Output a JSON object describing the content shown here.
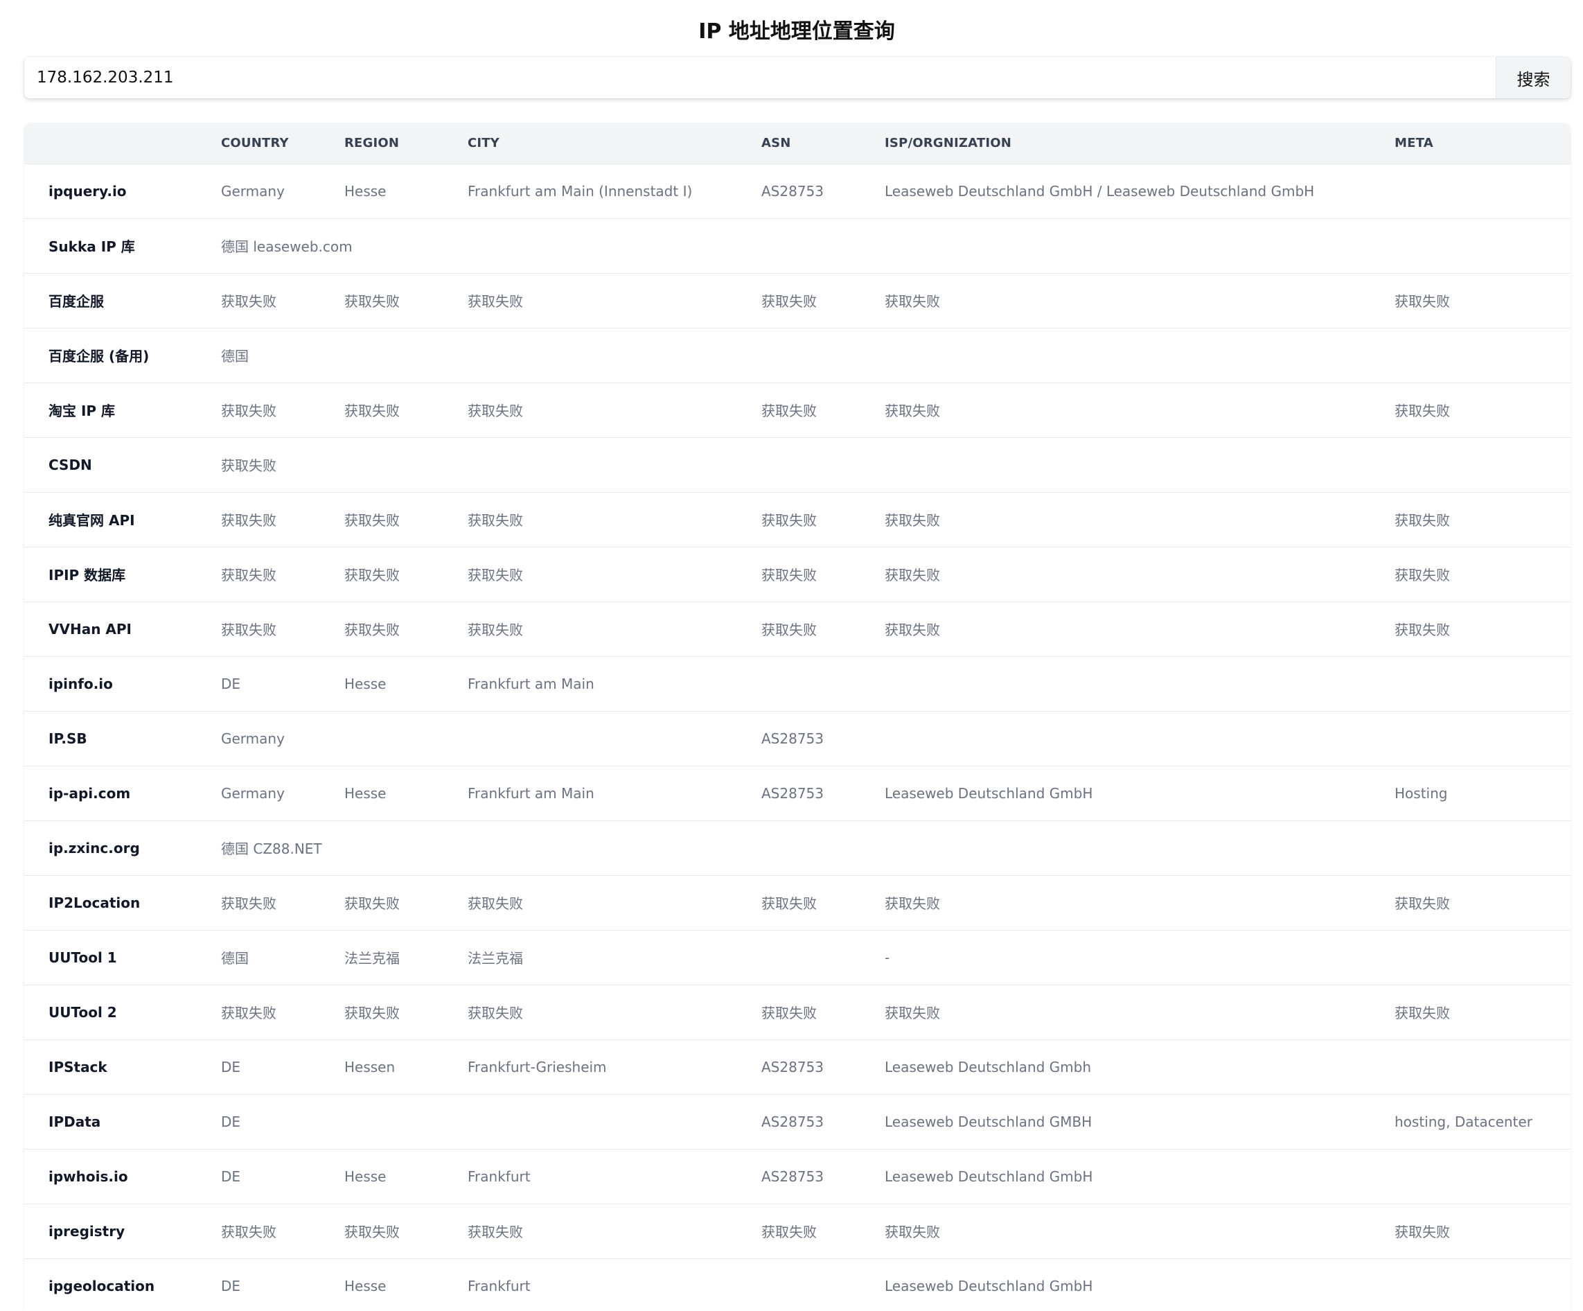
{
  "page": {
    "title": "IP 地址地理位置查询"
  },
  "search": {
    "value": "178.162.203.211",
    "button_label": "搜索"
  },
  "table": {
    "headers": [
      "",
      "COUNTRY",
      "REGION",
      "CITY",
      "ASN",
      "ISP/ORGNIZATION",
      "META"
    ],
    "rows": [
      {
        "cells": [
          "ipquery.io",
          "Germany",
          "Hesse",
          "Frankfurt am Main (Innenstadt I)",
          "AS28753",
          "Leaseweb Deutschland GmbH / Leaseweb Deutschland GmbH",
          ""
        ]
      },
      {
        "span": true,
        "cells": [
          "Sukka IP 库",
          "德国 leaseweb.com"
        ]
      },
      {
        "cells": [
          "百度企服",
          "获取失败",
          "获取失败",
          "获取失败",
          "获取失败",
          "获取失败",
          "获取失败"
        ]
      },
      {
        "span": true,
        "cells": [
          "百度企服 (备用)",
          "德国"
        ]
      },
      {
        "cells": [
          "淘宝 IP 库",
          "获取失败",
          "获取失败",
          "获取失败",
          "获取失败",
          "获取失败",
          "获取失败"
        ]
      },
      {
        "span": true,
        "cells": [
          "CSDN",
          "获取失败"
        ]
      },
      {
        "cells": [
          "纯真官网 API",
          "获取失败",
          "获取失败",
          "获取失败",
          "获取失败",
          "获取失败",
          "获取失败"
        ]
      },
      {
        "cells": [
          "IPIP 数据库",
          "获取失败",
          "获取失败",
          "获取失败",
          "获取失败",
          "获取失败",
          "获取失败"
        ]
      },
      {
        "cells": [
          "VVHan API",
          "获取失败",
          "获取失败",
          "获取失败",
          "获取失败",
          "获取失败",
          "获取失败"
        ]
      },
      {
        "cells": [
          "ipinfo.io",
          "DE",
          "Hesse",
          "Frankfurt am Main",
          "",
          "",
          ""
        ]
      },
      {
        "cells": [
          "IP.SB",
          "Germany",
          "",
          "",
          "AS28753",
          "",
          ""
        ]
      },
      {
        "cells": [
          "ip-api.com",
          "Germany",
          "Hesse",
          "Frankfurt am Main",
          "AS28753",
          "Leaseweb Deutschland GmbH",
          "Hosting"
        ]
      },
      {
        "span": true,
        "cells": [
          "ip.zxinc.org",
          "德国 CZ88.NET"
        ]
      },
      {
        "cells": [
          "IP2Location",
          "获取失败",
          "获取失败",
          "获取失败",
          "获取失败",
          "获取失败",
          "获取失败"
        ]
      },
      {
        "cells": [
          "UUTool 1",
          "德国",
          "法兰克福",
          "法兰克福",
          "",
          "-",
          ""
        ]
      },
      {
        "cells": [
          "UUTool 2",
          "获取失败",
          "获取失败",
          "获取失败",
          "获取失败",
          "获取失败",
          "获取失败"
        ]
      },
      {
        "cells": [
          "IPStack",
          "DE",
          "Hessen",
          "Frankfurt-Griesheim",
          "AS28753",
          "Leaseweb Deutschland Gmbh",
          ""
        ]
      },
      {
        "cells": [
          "IPData",
          "DE",
          "",
          "",
          "AS28753",
          "Leaseweb Deutschland GMBH",
          "hosting, Datacenter"
        ]
      },
      {
        "cells": [
          "ipwhois.io",
          "DE",
          "Hesse",
          "Frankfurt",
          "AS28753",
          "Leaseweb Deutschland GmbH",
          ""
        ]
      },
      {
        "cells": [
          "ipregistry",
          "获取失败",
          "获取失败",
          "获取失败",
          "获取失败",
          "获取失败",
          "获取失败"
        ]
      },
      {
        "cells": [
          "ipgeolocation",
          "DE",
          "Hesse",
          "Frankfurt",
          "",
          "Leaseweb Deutschland GmbH",
          ""
        ]
      }
    ]
  }
}
